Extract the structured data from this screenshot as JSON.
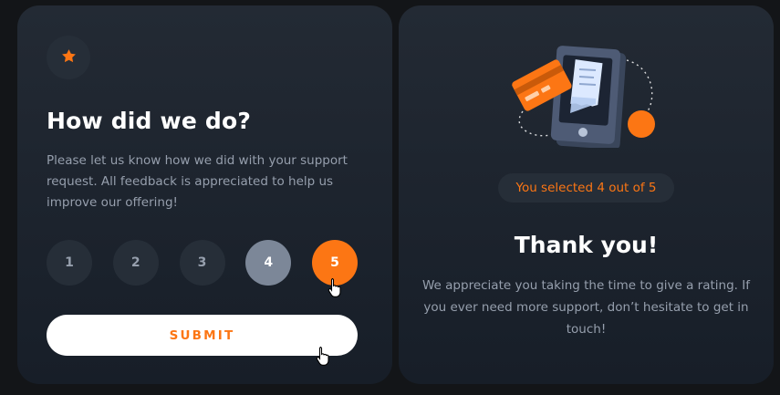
{
  "rating_card": {
    "star_icon": "star-icon",
    "title": "How did we do?",
    "description": "Please let us know how we did with your support request. All feedback is appreciated to help us improve our offering!",
    "ratings": [
      "1",
      "2",
      "3",
      "4",
      "5"
    ],
    "hovered_rating": "4",
    "selected_rating": "5",
    "submit_label": "SUBMIT"
  },
  "thank_you_card": {
    "illustration": "payment-illustration",
    "selected_text": "You selected 4 out of 5",
    "title": "Thank you!",
    "description": "We appreciate you taking the time to give a rating. If you ever need more support, don’t hesitate to get in touch!"
  },
  "colors": {
    "accent": "#fc7614",
    "background": "#131518",
    "card_top": "#232a34",
    "card_bottom": "#171e28",
    "circle": "#262e38",
    "muted_text": "#969fad",
    "hover_grey": "#7c8798"
  }
}
